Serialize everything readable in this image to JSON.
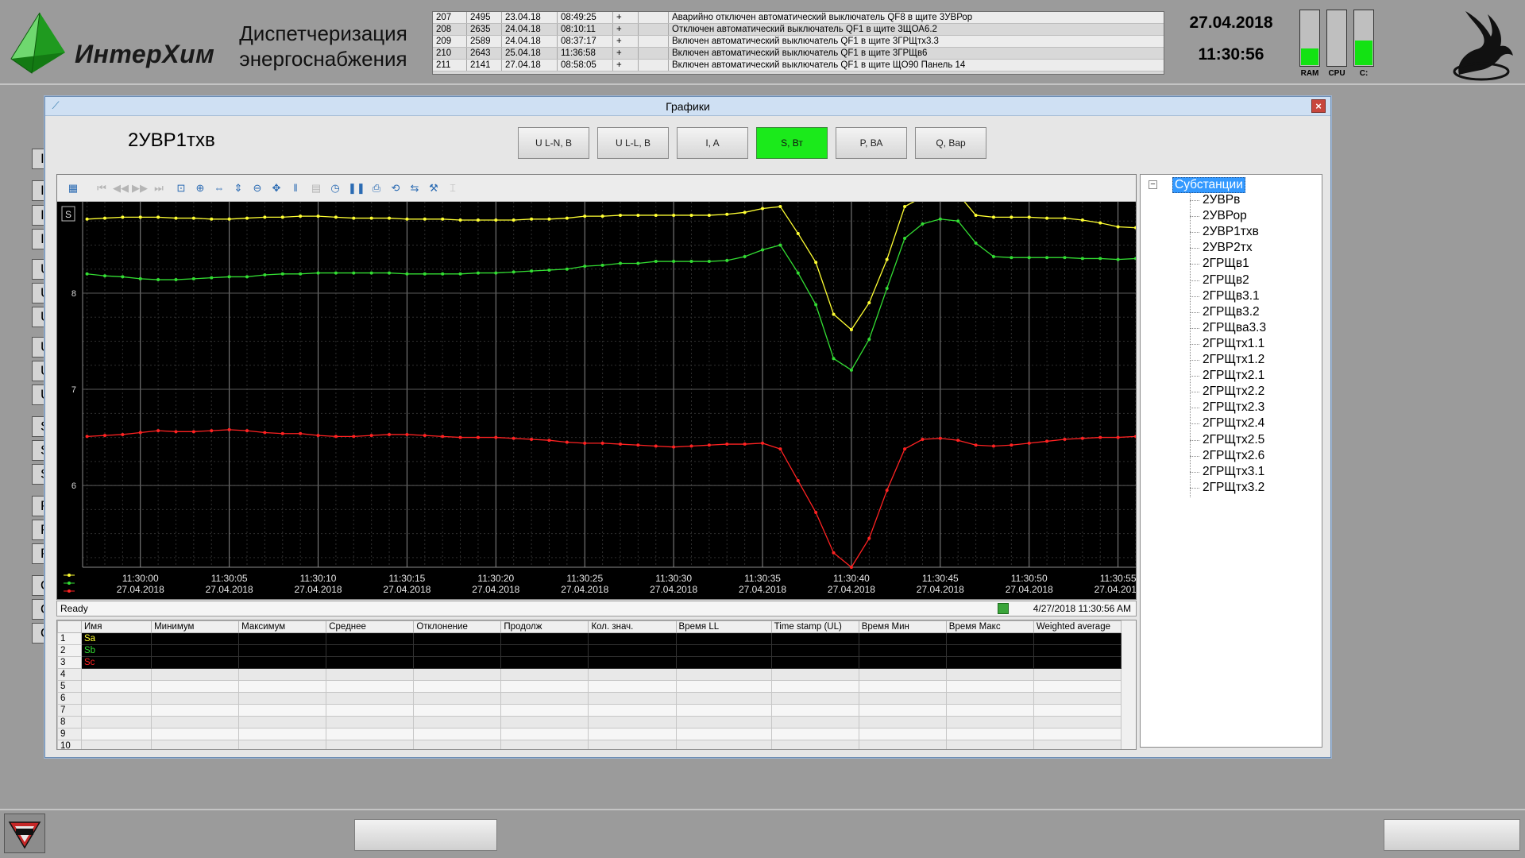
{
  "header": {
    "logo_text": "ИнтерХим",
    "app_title_line1": "Диспетчеризация",
    "app_title_line2": "энергоснабжения",
    "date": "27.04.2018",
    "time": "11:30:56",
    "events": [
      {
        "id": "207",
        "code": "2495",
        "date": "23.04.18",
        "time": "08:49:25",
        "mark": "+",
        "ack": "",
        "text": "Аварийно отключен автоматический выключатель QF8 в щите 3УВРор"
      },
      {
        "id": "208",
        "code": "2635",
        "date": "24.04.18",
        "time": "08:10:11",
        "mark": "+",
        "ack": "",
        "text": "Отключен автоматический выключатель QF1 в щите 3ЩОА6.2"
      },
      {
        "id": "209",
        "code": "2589",
        "date": "24.04.18",
        "time": "08:37:17",
        "mark": "+",
        "ack": "",
        "text": "Включен автоматический выключатель QF1 в щите 3ГРЩтх3.3"
      },
      {
        "id": "210",
        "code": "2643",
        "date": "25.04.18",
        "time": "11:36:58",
        "mark": "+",
        "ack": "",
        "text": "Включен автоматический выключатель QF1 в щите 3ГРЩв6"
      },
      {
        "id": "211",
        "code": "2141",
        "date": "27.04.18",
        "time": "08:58:05",
        "mark": "+",
        "ack": "",
        "text": "Включен автоматический выключатель QF1 в щите ЩО90 Панель 14"
      }
    ],
    "gauges": [
      {
        "label": "RAM",
        "level": 0.3
      },
      {
        "label": "CPU",
        "level": 0.0
      },
      {
        "label": "C:",
        "level": 0.45
      }
    ]
  },
  "left_stubs": [
    "I",
    "I",
    "I",
    "I",
    "U",
    "U",
    "U",
    "U",
    "U",
    "U",
    "S",
    "S",
    "S",
    "P",
    "P",
    "P",
    "Q",
    "Q",
    "Q"
  ],
  "window": {
    "title": "Графики",
    "close_label": "×",
    "object_name": "2УВР1тхв",
    "tabs": [
      {
        "label": "U L-N, В",
        "active": false
      },
      {
        "label": "U L-L, В",
        "active": false
      },
      {
        "label": "I, A",
        "active": false
      },
      {
        "label": "S, Вт",
        "active": true
      },
      {
        "label": "P, ВА",
        "active": false
      },
      {
        "label": "Q, Вар",
        "active": false
      }
    ],
    "status": {
      "left": "Ready",
      "right": "4/27/2018   11:30:56 AM"
    },
    "scale_badge": "S",
    "table": {
      "columns": [
        "Имя",
        "Минимум",
        "Максимум",
        "Среднее",
        "Отклонение",
        "Продолж",
        "Кол. знач.",
        "Время LL",
        "Time stamp (UL)",
        "Время Мин",
        "Время Макс",
        "Weighted average"
      ],
      "rows": [
        {
          "num": "1",
          "name": "Sa",
          "color": "#ffff33"
        },
        {
          "num": "2",
          "name": "Sb",
          "color": "#33dd33"
        },
        {
          "num": "3",
          "name": "Sc",
          "color": "#ff2222"
        },
        {
          "num": "4",
          "name": ""
        },
        {
          "num": "5",
          "name": ""
        },
        {
          "num": "6",
          "name": ""
        },
        {
          "num": "7",
          "name": ""
        },
        {
          "num": "8",
          "name": ""
        },
        {
          "num": "9",
          "name": ""
        },
        {
          "num": "10",
          "name": ""
        }
      ]
    },
    "tree": {
      "root": "Субстанции",
      "toggle": "−",
      "items": [
        "2УВРв",
        "2УВРор",
        "2УВР1тхв",
        "2УВР2тх",
        "2ГРЩв1",
        "2ГРЩв2",
        "2ГРЩв3.1",
        "2ГРЩв3.2",
        "2ГРЩва3.3",
        "2ГРЩтх1.1",
        "2ГРЩтх1.2",
        "2ГРЩтх2.1",
        "2ГРЩтх2.2",
        "2ГРЩтх2.3",
        "2ГРЩтх2.4",
        "2ГРЩтх2.5",
        "2ГРЩтх2.6",
        "2ГРЩтх3.1",
        "2ГРЩтх3.2"
      ]
    }
  },
  "chart_data": {
    "type": "line",
    "y_ticks": [
      "8",
      "7",
      "6"
    ],
    "ylim": [
      5.15,
      8.95
    ],
    "x_ticks": [
      {
        "time": "11:30:00",
        "date": "27.04.2018"
      },
      {
        "time": "11:30:05",
        "date": "27.04.2018"
      },
      {
        "time": "11:30:10",
        "date": "27.04.2018"
      },
      {
        "time": "11:30:15",
        "date": "27.04.2018"
      },
      {
        "time": "11:30:20",
        "date": "27.04.2018"
      },
      {
        "time": "11:30:25",
        "date": "27.04.2018"
      },
      {
        "time": "11:30:30",
        "date": "27.04.2018"
      },
      {
        "time": "11:30:35",
        "date": "27.04.2018"
      },
      {
        "time": "11:30:40",
        "date": "27.04.2018"
      },
      {
        "time": "11:30:45",
        "date": "27.04.2018"
      },
      {
        "time": "11:30:50",
        "date": "27.04.2018"
      },
      {
        "time": "11:30:55",
        "date": "27.04.2018"
      }
    ],
    "grid": true,
    "series": [
      {
        "name": "Sa",
        "color": "#ffff33",
        "x": [
          "11:29:57",
          "11:29:58",
          "11:29:59",
          "11:30:00",
          "11:30:01",
          "11:30:02",
          "11:30:03",
          "11:30:04",
          "11:30:05",
          "11:30:06",
          "11:30:07",
          "11:30:08",
          "11:30:09",
          "11:30:10",
          "11:30:11",
          "11:30:12",
          "11:30:13",
          "11:30:14",
          "11:30:15",
          "11:30:16",
          "11:30:17",
          "11:30:18",
          "11:30:19",
          "11:30:20",
          "11:30:21",
          "11:30:22",
          "11:30:23",
          "11:30:24",
          "11:30:25",
          "11:30:26",
          "11:30:27",
          "11:30:28",
          "11:30:29",
          "11:30:30",
          "11:30:31",
          "11:30:32",
          "11:30:33",
          "11:30:34",
          "11:30:35",
          "11:30:36",
          "11:30:37",
          "11:30:38",
          "11:30:39",
          "11:30:40",
          "11:30:41",
          "11:30:42",
          "11:30:43",
          "11:30:44",
          "11:30:45",
          "11:30:46",
          "11:30:47",
          "11:30:48",
          "11:30:49",
          "11:30:50",
          "11:30:51",
          "11:30:52",
          "11:30:53",
          "11:30:54",
          "11:30:55",
          "11:30:56"
        ],
        "values": [
          8.77,
          8.78,
          8.79,
          8.79,
          8.79,
          8.78,
          8.78,
          8.77,
          8.77,
          8.78,
          8.79,
          8.79,
          8.8,
          8.8,
          8.79,
          8.78,
          8.78,
          8.78,
          8.77,
          8.77,
          8.77,
          8.76,
          8.76,
          8.76,
          8.76,
          8.77,
          8.77,
          8.78,
          8.8,
          8.8,
          8.81,
          8.81,
          8.81,
          8.81,
          8.81,
          8.81,
          8.82,
          8.84,
          8.88,
          8.9,
          8.62,
          8.32,
          7.78,
          7.62,
          7.9,
          8.35,
          8.9,
          9.0,
          9.05,
          9.03,
          8.81,
          8.79,
          8.79,
          8.79,
          8.78,
          8.78,
          8.76,
          8.73,
          8.69,
          8.68
        ]
      },
      {
        "name": "Sb",
        "color": "#33dd33",
        "x": [
          "11:29:57",
          "11:29:58",
          "11:29:59",
          "11:30:00",
          "11:30:01",
          "11:30:02",
          "11:30:03",
          "11:30:04",
          "11:30:05",
          "11:30:06",
          "11:30:07",
          "11:30:08",
          "11:30:09",
          "11:30:10",
          "11:30:11",
          "11:30:12",
          "11:30:13",
          "11:30:14",
          "11:30:15",
          "11:30:16",
          "11:30:17",
          "11:30:18",
          "11:30:19",
          "11:30:20",
          "11:30:21",
          "11:30:22",
          "11:30:23",
          "11:30:24",
          "11:30:25",
          "11:30:26",
          "11:30:27",
          "11:30:28",
          "11:30:29",
          "11:30:30",
          "11:30:31",
          "11:30:32",
          "11:30:33",
          "11:30:34",
          "11:30:35",
          "11:30:36",
          "11:30:37",
          "11:30:38",
          "11:30:39",
          "11:30:40",
          "11:30:41",
          "11:30:42",
          "11:30:43",
          "11:30:44",
          "11:30:45",
          "11:30:46",
          "11:30:47",
          "11:30:48",
          "11:30:49",
          "11:30:50",
          "11:30:51",
          "11:30:52",
          "11:30:53",
          "11:30:54",
          "11:30:55",
          "11:30:56"
        ],
        "values": [
          8.2,
          8.18,
          8.17,
          8.15,
          8.14,
          8.14,
          8.15,
          8.16,
          8.17,
          8.17,
          8.19,
          8.2,
          8.2,
          8.21,
          8.21,
          8.21,
          8.21,
          8.21,
          8.2,
          8.2,
          8.2,
          8.2,
          8.21,
          8.21,
          8.22,
          8.23,
          8.24,
          8.25,
          8.28,
          8.29,
          8.31,
          8.31,
          8.33,
          8.33,
          8.33,
          8.33,
          8.34,
          8.38,
          8.45,
          8.5,
          8.21,
          7.88,
          7.32,
          7.2,
          7.52,
          8.05,
          8.57,
          8.72,
          8.77,
          8.75,
          8.52,
          8.38,
          8.37,
          8.37,
          8.37,
          8.37,
          8.36,
          8.36,
          8.35,
          8.36
        ]
      },
      {
        "name": "Sc",
        "color": "#ff2222",
        "x": [
          "11:29:57",
          "11:29:58",
          "11:29:59",
          "11:30:00",
          "11:30:01",
          "11:30:02",
          "11:30:03",
          "11:30:04",
          "11:30:05",
          "11:30:06",
          "11:30:07",
          "11:30:08",
          "11:30:09",
          "11:30:10",
          "11:30:11",
          "11:30:12",
          "11:30:13",
          "11:30:14",
          "11:30:15",
          "11:30:16",
          "11:30:17",
          "11:30:18",
          "11:30:19",
          "11:30:20",
          "11:30:21",
          "11:30:22",
          "11:30:23",
          "11:30:24",
          "11:30:25",
          "11:30:26",
          "11:30:27",
          "11:30:28",
          "11:30:29",
          "11:30:30",
          "11:30:31",
          "11:30:32",
          "11:30:33",
          "11:30:34",
          "11:30:35",
          "11:30:36",
          "11:30:37",
          "11:30:38",
          "11:30:39",
          "11:30:40",
          "11:30:41",
          "11:30:42",
          "11:30:43",
          "11:30:44",
          "11:30:45",
          "11:30:46",
          "11:30:47",
          "11:30:48",
          "11:30:49",
          "11:30:50",
          "11:30:51",
          "11:30:52",
          "11:30:53",
          "11:30:54",
          "11:30:55",
          "11:30:56"
        ],
        "values": [
          6.51,
          6.52,
          6.53,
          6.55,
          6.57,
          6.56,
          6.56,
          6.57,
          6.58,
          6.57,
          6.55,
          6.54,
          6.54,
          6.52,
          6.51,
          6.51,
          6.52,
          6.53,
          6.53,
          6.52,
          6.51,
          6.5,
          6.5,
          6.5,
          6.49,
          6.48,
          6.47,
          6.45,
          6.44,
          6.44,
          6.43,
          6.42,
          6.41,
          6.4,
          6.41,
          6.42,
          6.43,
          6.43,
          6.44,
          6.38,
          6.05,
          5.72,
          5.3,
          5.15,
          5.45,
          5.95,
          6.38,
          6.48,
          6.49,
          6.47,
          6.42,
          6.41,
          6.42,
          6.44,
          6.46,
          6.48,
          6.49,
          6.5,
          6.5,
          6.51
        ]
      }
    ]
  }
}
